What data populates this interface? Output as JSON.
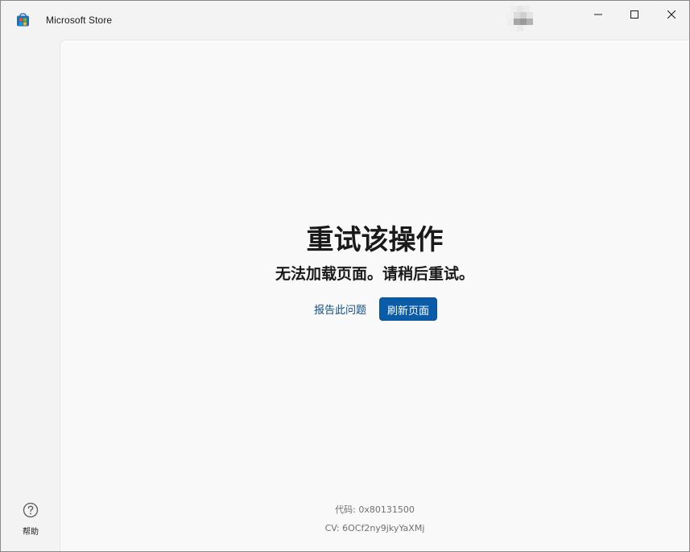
{
  "window": {
    "title": "Microsoft Store"
  },
  "titlebar": {
    "app_icon": "microsoft-store-icon",
    "avatar": "user-avatar",
    "minimize_icon": "minimize-icon",
    "maximize_icon": "maximize-icon",
    "close_icon": "close-icon"
  },
  "rail": {
    "help_label": "帮助",
    "help_icon": "help-circle-icon"
  },
  "error": {
    "title": "重试该操作",
    "message": "无法加载页面。请稍后重试。",
    "report_label": "报告此问题",
    "refresh_label": "刷新页面"
  },
  "footer": {
    "code": "代码: 0x80131500",
    "cv": "CV: 6OCf2ny9jkyYaXMj"
  },
  "colors": {
    "accent": "#0a5ba8",
    "link": "#0e4f8a",
    "content_bg": "#f9f9f9",
    "chrome_bg": "#f3f3f3"
  }
}
